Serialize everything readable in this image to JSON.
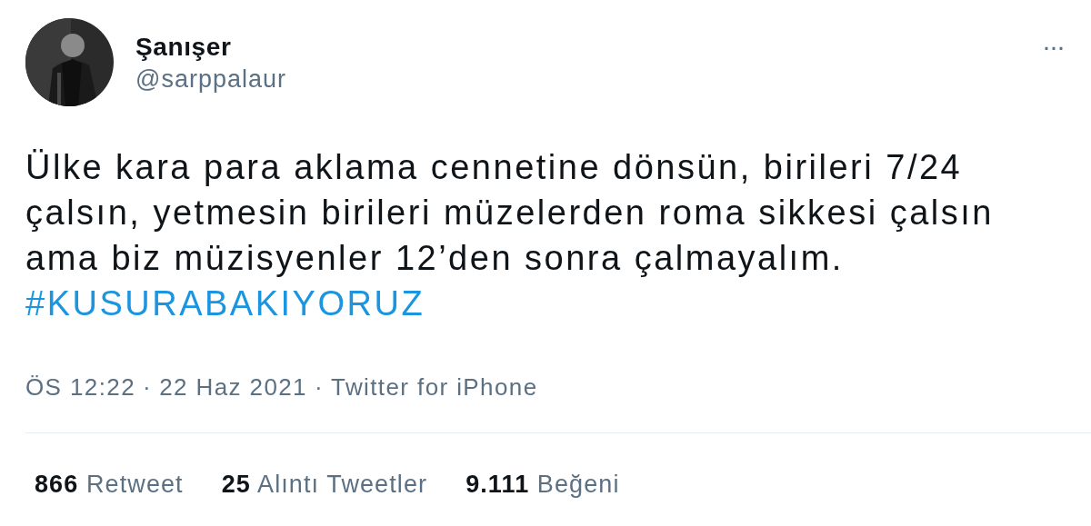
{
  "author": {
    "name": "Şanışer",
    "handle": "@sarppalaur"
  },
  "more_menu": "···",
  "body_lines": [
    "Ülke kara para aklama cennetine dönsün, birileri 7/24",
    "çalsın, yetmesin birileri müzelerden roma sikkesi çalsın",
    "ama biz müzisyenler 12’den sonra çalmayalım."
  ],
  "hashtag": "#KUSURABAKIYORUZ",
  "meta": {
    "time": "ÖS 12:22",
    "separator_1": "·",
    "date": "22 Haz 2021",
    "separator_2": "·",
    "source": "Twitter for iPhone"
  },
  "stats": [
    {
      "count": "866",
      "label": "Retweet"
    },
    {
      "count": "25",
      "label": "Alıntı Tweetler"
    },
    {
      "count": "9.111",
      "label": "Beğeni"
    }
  ]
}
